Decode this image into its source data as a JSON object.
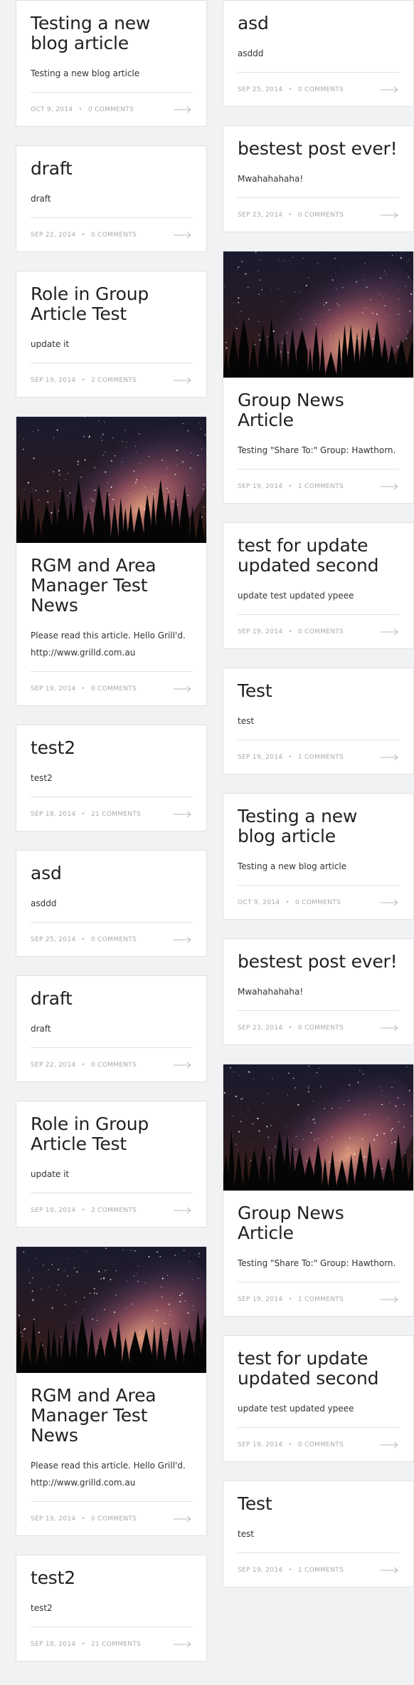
{
  "colors": {
    "background": "#f1f2f3",
    "card": "#ffffff",
    "title": "#222222",
    "meta": "#aaaaaa",
    "arrow": "#bbbbbb"
  },
  "icons": {
    "read_more": "long-arrow-right-icon",
    "thumbnail": "night-sky-image"
  },
  "left_column": [
    {
      "title": "Testing a new blog article",
      "excerpt": "Testing a new blog article",
      "date": "OCT 9, 2014",
      "comments": "0 COMMENTS",
      "has_image": false
    },
    {
      "title": "draft",
      "excerpt": "draft",
      "date": "SEP 22, 2014",
      "comments": "0 COMMENTS",
      "has_image": false
    },
    {
      "title": "Role in Group Article Test",
      "excerpt": "update it",
      "date": "SEP 19, 2014",
      "comments": "2 COMMENTS",
      "has_image": false
    },
    {
      "title": "RGM and Area Manager Test News",
      "excerpt": "Please read this article. Hello Grill'd. http://www.grilld.com.au",
      "date": "SEP 19, 2014",
      "comments": "0 COMMENTS",
      "has_image": true
    },
    {
      "title": "test2",
      "excerpt": "test2",
      "date": "SEP 18, 2014",
      "comments": "21 COMMENTS",
      "has_image": false
    },
    {
      "title": "asd",
      "excerpt": "asddd",
      "date": "SEP 25, 2014",
      "comments": "0 COMMENTS",
      "has_image": false
    },
    {
      "title": "draft",
      "excerpt": "draft",
      "date": "SEP 22, 2014",
      "comments": "0 COMMENTS",
      "has_image": false
    },
    {
      "title": "Role in Group Article Test",
      "excerpt": "update it",
      "date": "SEP 19, 2014",
      "comments": "2 COMMENTS",
      "has_image": false
    },
    {
      "title": "RGM and Area Manager Test News",
      "excerpt": "Please read this article. Hello Grill'd. http://www.grilld.com.au",
      "date": "SEP 19, 2014",
      "comments": "0 COMMENTS",
      "has_image": true
    },
    {
      "title": "test2",
      "excerpt": "test2",
      "date": "SEP 18, 2014",
      "comments": "21 COMMENTS",
      "has_image": false
    }
  ],
  "right_column": [
    {
      "title": "asd",
      "excerpt": "asddd",
      "date": "SEP 25, 2014",
      "comments": "0 COMMENTS",
      "has_image": false
    },
    {
      "title": "bestest post ever!",
      "excerpt": "Mwahahahaha!",
      "date": "SEP 23, 2014",
      "comments": "0 COMMENTS",
      "has_image": false
    },
    {
      "title": "Group News Article",
      "excerpt": "Testing \"Share To:\" Group: Hawthorn.",
      "date": "SEP 19, 2014",
      "comments": "1 COMMENTS",
      "has_image": true
    },
    {
      "title": "test for update updated second",
      "excerpt": "update test updated ypeee",
      "date": "SEP 19, 2014",
      "comments": "0 COMMENTS",
      "has_image": false
    },
    {
      "title": "Test",
      "excerpt": "test",
      "date": "SEP 19, 2014",
      "comments": "1 COMMENTS",
      "has_image": false
    },
    {
      "title": "Testing a new blog article",
      "excerpt": "Testing a new blog article",
      "date": "OCT 9, 2014",
      "comments": "0 COMMENTS",
      "has_image": false
    },
    {
      "title": "bestest post ever!",
      "excerpt": "Mwahahahaha!",
      "date": "SEP 23, 2014",
      "comments": "0 COMMENTS",
      "has_image": false
    },
    {
      "title": "Group News Article",
      "excerpt": "Testing \"Share To:\" Group: Hawthorn.",
      "date": "SEP 19, 2014",
      "comments": "1 COMMENTS",
      "has_image": true
    },
    {
      "title": "test for update updated second",
      "excerpt": "update test updated ypeee",
      "date": "SEP 19, 2014",
      "comments": "0 COMMENTS",
      "has_image": false
    },
    {
      "title": "Test",
      "excerpt": "test",
      "date": "SEP 19, 2014",
      "comments": "1 COMMENTS",
      "has_image": false
    }
  ]
}
